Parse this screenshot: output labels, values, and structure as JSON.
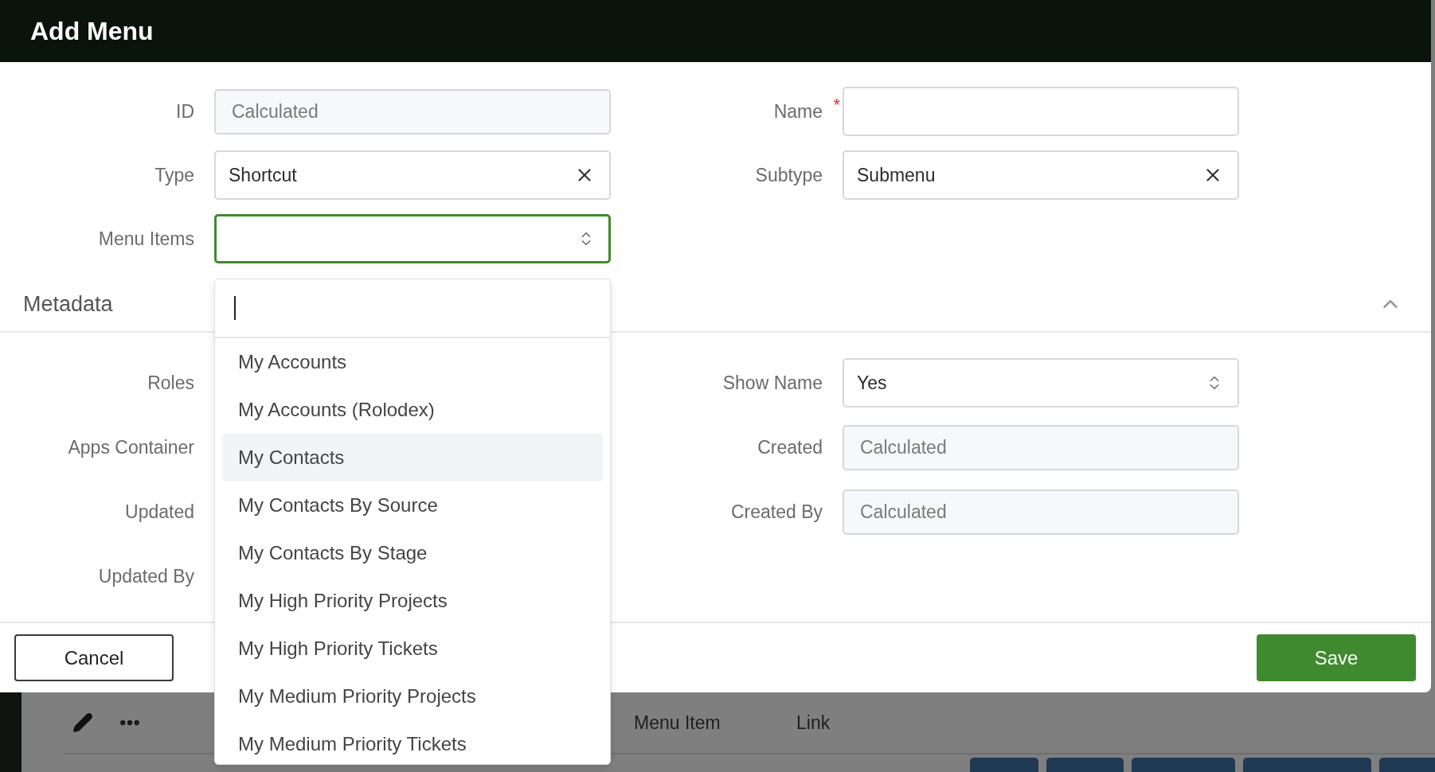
{
  "dialog": {
    "title": "Add Menu",
    "rows": [
      [
        {
          "label": "ID",
          "kind": "readonly",
          "placeholder": "Calculated"
        },
        {
          "label": "Name",
          "kind": "text",
          "required_mark": "*"
        }
      ],
      [
        {
          "label": "Type",
          "kind": "clearable",
          "value": "Shortcut"
        },
        {
          "label": "Subtype",
          "kind": "clearable",
          "value": "Submenu"
        }
      ],
      [
        {
          "label": "Menu Items",
          "kind": "select",
          "focused": true
        }
      ]
    ],
    "section": {
      "title": "Metadata",
      "expanded": true,
      "rows": [
        [
          {
            "label": "Roles",
            "kind": "hidden"
          },
          {
            "label": "Show Name",
            "kind": "select",
            "value": "Yes",
            "focused": false
          }
        ],
        [
          {
            "label": "Apps Container",
            "kind": "hidden"
          },
          {
            "label": "Created",
            "kind": "readonly",
            "placeholder": "Calculated"
          }
        ],
        [
          {
            "label": "Updated",
            "kind": "hidden"
          },
          {
            "label": "Created By",
            "kind": "readonly",
            "placeholder": "Calculated"
          }
        ],
        [
          {
            "label": "Updated By",
            "kind": "hidden"
          }
        ]
      ]
    },
    "buttons": {
      "cancel": "Cancel",
      "save": "Save"
    }
  },
  "dropdown": {
    "items": [
      {
        "label": "My Accounts",
        "highlighted": false
      },
      {
        "label": "My Accounts (Rolodex)",
        "highlighted": false
      },
      {
        "label": "My Contacts",
        "highlighted": true
      },
      {
        "label": "My Contacts By Source",
        "highlighted": false
      },
      {
        "label": "My Contacts By Stage",
        "highlighted": false
      },
      {
        "label": "My High Priority Projects",
        "highlighted": false
      },
      {
        "label": "My High Priority Tickets",
        "highlighted": false
      },
      {
        "label": "My Medium Priority Projects",
        "highlighted": false
      },
      {
        "label": "My Medium Priority Tickets",
        "highlighted": false
      }
    ]
  },
  "background": {
    "columns": [
      "Menu Item",
      "Link"
    ]
  }
}
